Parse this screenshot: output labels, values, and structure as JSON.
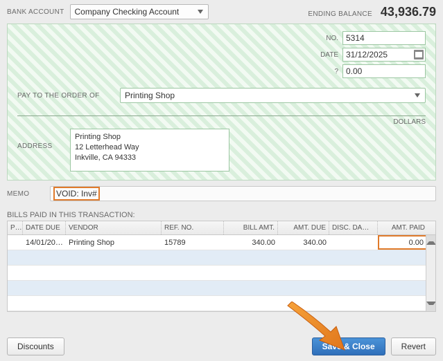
{
  "header": {
    "bank_account_label": "BANK ACCOUNT",
    "bank_account_value": "Company Checking Account",
    "ending_balance_label": "ENDING BALANCE",
    "ending_balance_value": "43,936.79"
  },
  "check": {
    "no_label": "NO.",
    "no_value": "5314",
    "date_label": "DATE",
    "date_value": "31/12/2025",
    "amount_label": "?",
    "amount_value": "0.00",
    "payee_label": "PAY TO THE ORDER OF",
    "payee_value": "Printing Shop",
    "dollars_label": "DOLLARS",
    "address_label": "ADDRESS",
    "address_value": "Printing Shop\n12 Letterhead Way\nInkville, CA 94333"
  },
  "memo": {
    "label": "MEMO",
    "value": "VOID: Inv#"
  },
  "bills": {
    "title": "BILLS PAID IN THIS TRANSACTION:",
    "columns": {
      "p": "P…",
      "date_due": "DATE DUE",
      "vendor": "VENDOR",
      "ref_no": "REF. NO.",
      "bill_amt": "BILL AMT.",
      "amt_due": "AMT. DUE",
      "disc_date": "DISC. DA…",
      "amt_paid": "AMT. PAID"
    },
    "rows": [
      {
        "p": "",
        "date_due": "14/01/20…",
        "vendor": "Printing Shop",
        "ref_no": "15789",
        "bill_amt": "340.00",
        "amt_due": "340.00",
        "disc_date": "",
        "amt_paid": "0.00"
      }
    ]
  },
  "footer": {
    "discounts": "Discounts",
    "save_close": "Save & Close",
    "revert": "Revert"
  }
}
